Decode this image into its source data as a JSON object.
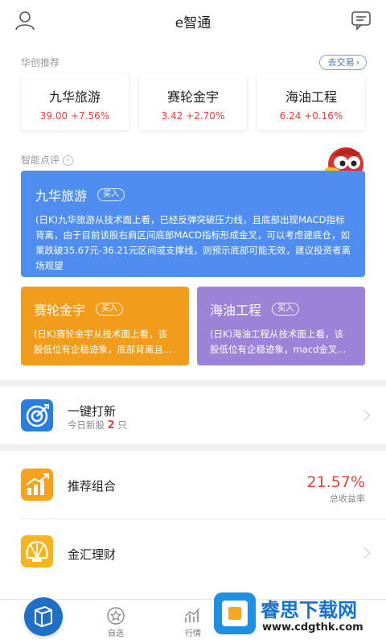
{
  "header": {
    "title": "e智通",
    "user_icon": "user-icon",
    "message_icon": "message-icon"
  },
  "recommend": {
    "section_title": "华创推荐",
    "trade_button": "去交易",
    "trade_chevron": "›",
    "stocks": [
      {
        "name": "九华旅游",
        "price": "39.00",
        "change": "+7.56%"
      },
      {
        "name": "赛轮金宇",
        "price": "3.42",
        "change": "+2.70%"
      },
      {
        "name": "海油工程",
        "price": "6.24",
        "change": "+0.16%"
      }
    ]
  },
  "smart_comment": {
    "section_title": "智能点评",
    "info_glyph": "›",
    "cards": [
      {
        "name": "九华旅游",
        "badge": "买入",
        "text": "(日K)九华旅游从技术面上看，已经反弹突破压力线，且底部出现MACD指标背离，由于目前该股右肩区间底部MACD指标形成金叉，可以考虑建底仓，如果跌破35.67元-36.21元区间或支撑线，则预示底部可能无效，建议投资者离场观望",
        "color": "#4f8ef0"
      },
      {
        "name": "赛轮金宇",
        "badge": "买入",
        "text": "(日K)赛轮金宇从技术面上看，该股低位有企稳迹象，底部背离且...",
        "color": "#f19c1b"
      },
      {
        "name": "海油工程",
        "badge": "买入",
        "text": "(日K)海油工程从技术面上看，该股低位有企稳迹象，macd金叉...",
        "color": "#9c83d8"
      }
    ]
  },
  "list": {
    "ipo": {
      "label": "一键打新",
      "sub_prefix": "今日新股",
      "sub_count": "2",
      "sub_suffix": "只"
    },
    "portfolio": {
      "label": "推荐组合",
      "rate": "21.57%",
      "rate_label": "总收益率"
    },
    "finance": {
      "label": "金汇理财"
    }
  },
  "tabbar": {
    "tabs": [
      {
        "label": "",
        "icon": "home-icon"
      },
      {
        "label": "自选",
        "icon": "star-icon"
      },
      {
        "label": "行情",
        "icon": "chart-icon"
      },
      {
        "label": "",
        "icon": "trade-icon"
      },
      {
        "label": "",
        "icon": "more-icon"
      }
    ]
  },
  "watermark": {
    "title": "睿思下载网",
    "url": "www.cdgthk.com"
  },
  "colors": {
    "up_red": "#e2433a",
    "brand_blue": "#1f6fc5",
    "card_blue": "#4f8ef0",
    "card_orange": "#f19c1b",
    "card_purple": "#9c83d8"
  }
}
